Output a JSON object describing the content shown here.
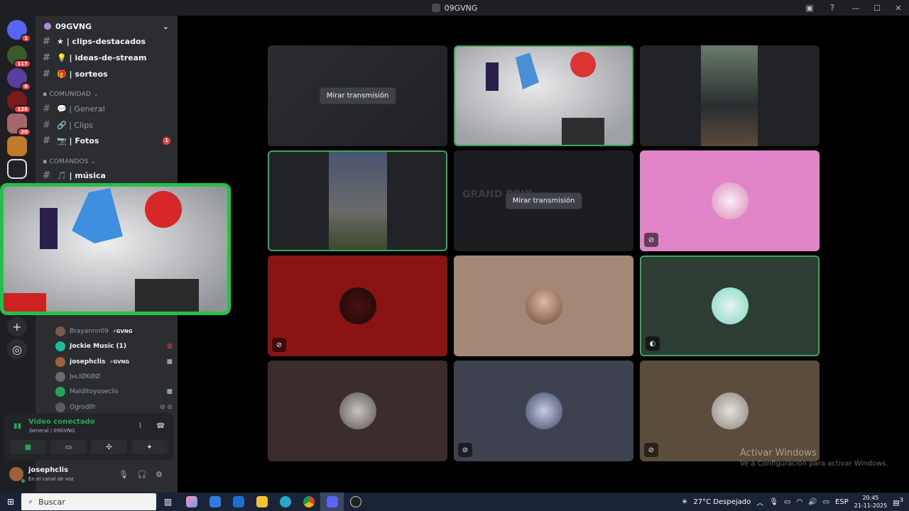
{
  "window": {
    "title": "09GVNG"
  },
  "servers": [
    {
      "badge": "1"
    },
    {
      "badge": "117"
    },
    {
      "badge": "6"
    },
    {
      "badge": "126"
    },
    {
      "badge": "20"
    },
    {
      "badge": ""
    },
    {
      "badge": ""
    }
  ],
  "sidebar": {
    "server_name": "09GVNG",
    "channels_top": [
      {
        "label": "★ | clips-destacados"
      },
      {
        "label": "💡 | ideas-de-stream"
      },
      {
        "label": "🎁 | sorteos"
      }
    ],
    "cat_comunidad": "COMUNIDAD",
    "channels_comunidad": [
      {
        "label": "💬 | General"
      },
      {
        "label": "🔗 | Clips"
      },
      {
        "label": "📷 | Fotos",
        "badge": "1"
      }
    ],
    "cat_comandos": "COMANDOS",
    "channels_comandos": [
      {
        "label": "🎵 | música"
      }
    ]
  },
  "members": [
    {
      "name": "Brayannn09",
      "tag": "⚡GVNG"
    },
    {
      "name": "Jockie Music (1)"
    },
    {
      "name": "josephclis",
      "tag": "⚡GVNG"
    },
    {
      "name": "JʜʟIØKØØ"
    },
    {
      "name": "Malditoyoseclis"
    },
    {
      "name": "Ogrodlfr"
    }
  ],
  "voice": {
    "status": "Video conectado",
    "location": "General / 09GVNG"
  },
  "user": {
    "name": "josephclis",
    "status": "En el canal de voz"
  },
  "grid": {
    "watch_label": "Mirar transmisión",
    "grand_prix": "GRAND PRIX"
  },
  "watermark": {
    "line1": "Activar Windows",
    "line2": "Ve a Configuración para activar Windows."
  },
  "taskbar": {
    "search": "Buscar",
    "weather": "27°C  Despejado",
    "lang": "ESP",
    "time": "20:45",
    "date": "21-11-2025",
    "notif": "3"
  },
  "colors": {
    "accent_green": "#23a55a",
    "speaking_border": "#3ba55d",
    "popout_border": "#23c04a"
  }
}
